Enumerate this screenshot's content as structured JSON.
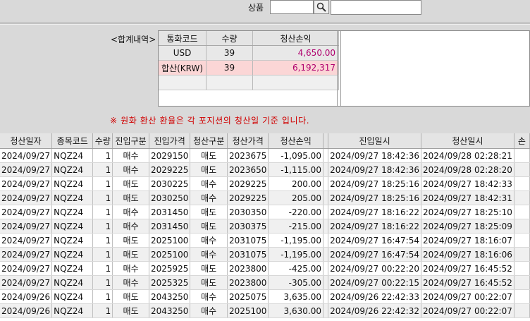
{
  "product": {
    "label": "상품",
    "code_value": "",
    "name_value": "",
    "search_icon": "magnifier-icon"
  },
  "summary": {
    "label": "<합계내역>",
    "headers": [
      "통화코드",
      "수량",
      "청산손익"
    ],
    "rows": [
      {
        "currency": "USD",
        "qty": "39",
        "pnl": "4,650.00"
      },
      {
        "currency": "합산(KRW)",
        "qty": "39",
        "pnl": "6,192,317"
      }
    ]
  },
  "notice": "※ 원화 환산 환율은 각 포지션의 청산일 기준 입니다.",
  "grid": {
    "headers": [
      "청산일자",
      "종목코드",
      "수량",
      "진입구분",
      "진입가격",
      "청산구분",
      "청산가격",
      "청산손익",
      "",
      "진입일시",
      "청산일시",
      "손"
    ],
    "rows": [
      {
        "date": "2024/09/27",
        "code": "NQZ24",
        "qty": "1",
        "entry_type": "매수",
        "entry_price": "2029150",
        "exit_type": "매도",
        "exit_price": "2023675",
        "pnl": "-1,095.00",
        "entry_time": "2024/09/27  18:42:36",
        "exit_time": "2024/09/28  02:28:21"
      },
      {
        "date": "2024/09/27",
        "code": "NQZ24",
        "qty": "1",
        "entry_type": "매수",
        "entry_price": "2029225",
        "exit_type": "매도",
        "exit_price": "2023650",
        "pnl": "-1,115.00",
        "entry_time": "2024/09/27  18:42:36",
        "exit_time": "2024/09/28  02:28:20"
      },
      {
        "date": "2024/09/27",
        "code": "NQZ24",
        "qty": "1",
        "entry_type": "매도",
        "entry_price": "2030225",
        "exit_type": "매수",
        "exit_price": "2029225",
        "pnl": "200.00",
        "entry_time": "2024/09/27  18:25:16",
        "exit_time": "2024/09/27  18:42:33"
      },
      {
        "date": "2024/09/27",
        "code": "NQZ24",
        "qty": "1",
        "entry_type": "매도",
        "entry_price": "2030250",
        "exit_type": "매수",
        "exit_price": "2029225",
        "pnl": "205.00",
        "entry_time": "2024/09/27  18:25:16",
        "exit_time": "2024/09/27  18:42:31"
      },
      {
        "date": "2024/09/27",
        "code": "NQZ24",
        "qty": "1",
        "entry_type": "매수",
        "entry_price": "2031450",
        "exit_type": "매도",
        "exit_price": "2030350",
        "pnl": "-220.00",
        "entry_time": "2024/09/27  18:16:22",
        "exit_time": "2024/09/27  18:25:10"
      },
      {
        "date": "2024/09/27",
        "code": "NQZ24",
        "qty": "1",
        "entry_type": "매수",
        "entry_price": "2031450",
        "exit_type": "매도",
        "exit_price": "2030375",
        "pnl": "-215.00",
        "entry_time": "2024/09/27  18:16:22",
        "exit_time": "2024/09/27  18:25:09"
      },
      {
        "date": "2024/09/27",
        "code": "NQZ24",
        "qty": "1",
        "entry_type": "매도",
        "entry_price": "2025100",
        "exit_type": "매수",
        "exit_price": "2031075",
        "pnl": "-1,195.00",
        "entry_time": "2024/09/27  16:47:54",
        "exit_time": "2024/09/27  18:16:07"
      },
      {
        "date": "2024/09/27",
        "code": "NQZ24",
        "qty": "1",
        "entry_type": "매도",
        "entry_price": "2025100",
        "exit_type": "매수",
        "exit_price": "2031075",
        "pnl": "-1,195.00",
        "entry_time": "2024/09/27  16:47:54",
        "exit_time": "2024/09/27  18:16:06"
      },
      {
        "date": "2024/09/27",
        "code": "NQZ24",
        "qty": "1",
        "entry_type": "매수",
        "entry_price": "2025925",
        "exit_type": "매도",
        "exit_price": "2023800",
        "pnl": "-425.00",
        "entry_time": "2024/09/27  00:22:20",
        "exit_time": "2024/09/27  16:45:52"
      },
      {
        "date": "2024/09/27",
        "code": "NQZ24",
        "qty": "1",
        "entry_type": "매수",
        "entry_price": "2025325",
        "exit_type": "매도",
        "exit_price": "2023800",
        "pnl": "-305.00",
        "entry_time": "2024/09/27  00:22:15",
        "exit_time": "2024/09/27  16:45:52"
      },
      {
        "date": "2024/09/26",
        "code": "NQZ24",
        "qty": "1",
        "entry_type": "매도",
        "entry_price": "2043250",
        "exit_type": "매수",
        "exit_price": "2025075",
        "pnl": "3,635.00",
        "entry_time": "2024/09/26  22:42:33",
        "exit_time": "2024/09/27  00:22:07"
      },
      {
        "date": "2024/09/26",
        "code": "NQZ24",
        "qty": "1",
        "entry_type": "매도",
        "entry_price": "2043250",
        "exit_type": "매수",
        "exit_price": "2025100",
        "pnl": "3,630.00",
        "entry_time": "2024/09/26  22:42:32",
        "exit_time": "2024/09/27  00:22:07"
      }
    ]
  },
  "colors": {
    "buy": "#b0006e",
    "sell": "#0f2fa8",
    "notice": "#d00000",
    "krw_row": "#fbd6d6"
  }
}
